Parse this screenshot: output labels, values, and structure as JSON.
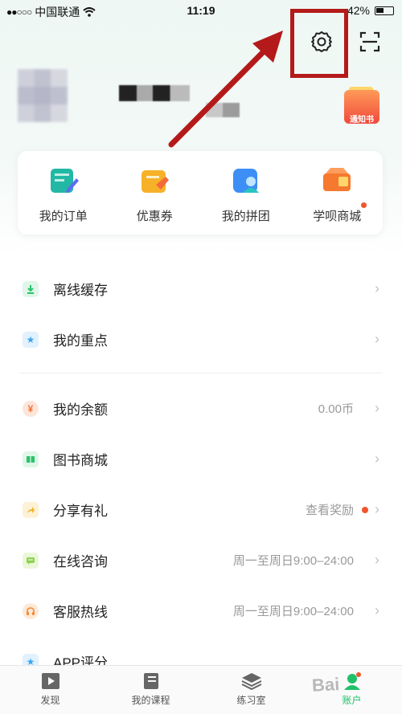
{
  "status_bar": {
    "signal_dots": "●●○○○",
    "carrier": "中国联通",
    "time": "11:19",
    "battery": "42%"
  },
  "header": {
    "notice_label": "通知书"
  },
  "quick_actions": [
    {
      "label": "我的订单",
      "icon": "order-icon",
      "color": "#22b8a5"
    },
    {
      "label": "优惠券",
      "icon": "coupon-icon",
      "color": "#f6b129"
    },
    {
      "label": "我的拼团",
      "icon": "group-buy-icon",
      "color": "#3d8ef5"
    },
    {
      "label": "学呗商城",
      "icon": "mall-icon",
      "color": "#f5792f"
    }
  ],
  "menu": {
    "offline": {
      "label": "离线缓存",
      "icon_color": "#2cc36b"
    },
    "highlights": {
      "label": "我的重点",
      "icon_color": "#3da5f0"
    },
    "balance": {
      "label": "我的余额",
      "value": "0.00币",
      "icon_color": "#f2733a"
    },
    "bookstore": {
      "label": "图书商城",
      "icon_color": "#2cc36b"
    },
    "share": {
      "label": "分享有礼",
      "value": "查看奖励",
      "icon_color": "#f6b129"
    },
    "consult": {
      "label": "在线咨询",
      "value": "周一至周日9:00–24:00",
      "icon_color": "#8fd14f"
    },
    "hotline": {
      "label": "客服热线",
      "value": "周一至周日9:00–24:00",
      "icon_color": "#f2893a"
    },
    "rating": {
      "label": "APP评分",
      "icon_color": "#3da5f0"
    }
  },
  "tabs": [
    {
      "label": "发现"
    },
    {
      "label": "我的课程"
    },
    {
      "label": "练习室"
    },
    {
      "label": "账户"
    }
  ],
  "watermark": "Bai",
  "colors": {
    "accent": "#20c06a",
    "annotation": "#b41a1a"
  }
}
